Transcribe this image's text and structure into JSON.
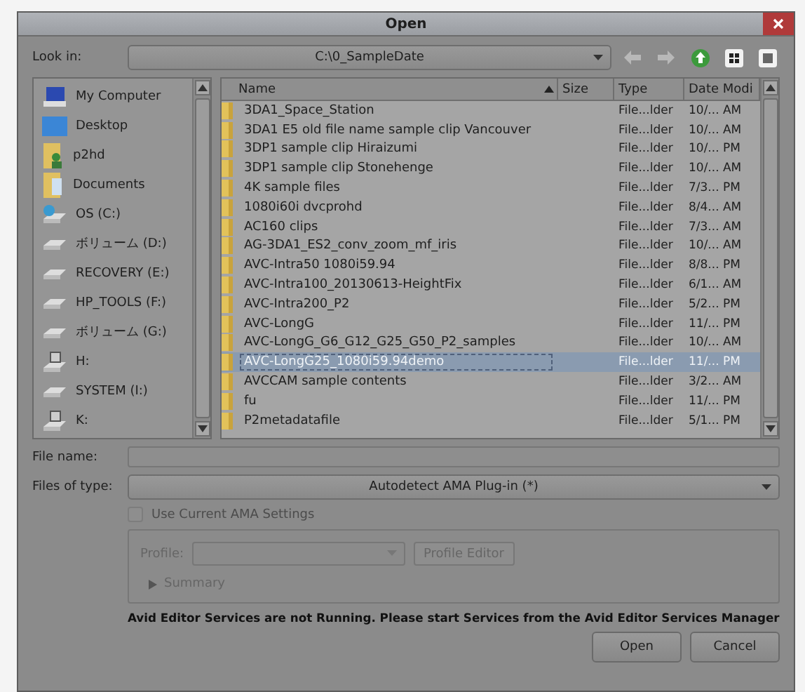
{
  "window": {
    "title": "Open"
  },
  "look_in": {
    "label": "Look in:",
    "value": "C:\\0_SampleDate"
  },
  "sidebar": {
    "items": [
      {
        "label": "My Computer",
        "kind": "computer"
      },
      {
        "label": "Desktop",
        "kind": "desktop"
      },
      {
        "label": "p2hd",
        "kind": "userfolder"
      },
      {
        "label": "Documents",
        "kind": "folder"
      },
      {
        "label": "OS (C:)",
        "kind": "osdrive"
      },
      {
        "label": "ボリューム (D:)",
        "kind": "drive"
      },
      {
        "label": "RECOVERY (E:)",
        "kind": "drive"
      },
      {
        "label": "HP_TOOLS (F:)",
        "kind": "drive"
      },
      {
        "label": "ボリューム (G:)",
        "kind": "drive"
      },
      {
        "label": "H:",
        "kind": "netdrive"
      },
      {
        "label": "SYSTEM (I:)",
        "kind": "drive"
      },
      {
        "label": "K:",
        "kind": "netdrive"
      }
    ]
  },
  "table": {
    "columns": [
      {
        "label": "Name",
        "sorted": true
      },
      {
        "label": "Size",
        "sorted": false
      },
      {
        "label": "Type",
        "sorted": false
      },
      {
        "label": "Date Modi",
        "sorted": false
      }
    ],
    "rows": [
      {
        "name": "3DA1_Space_Station",
        "type": "File...lder",
        "date": "10/... AM",
        "selected": false
      },
      {
        "name": "3DA1 E5 old file name sample clip Vancouver",
        "type": "File...lder",
        "date": "10/... AM",
        "selected": false
      },
      {
        "name": "3DP1 sample clip Hiraizumi",
        "type": "File...lder",
        "date": "10/... PM",
        "selected": false
      },
      {
        "name": "3DP1 sample clip Stonehenge",
        "type": "File...lder",
        "date": "10/... AM",
        "selected": false
      },
      {
        "name": "4K sample files",
        "type": "File...lder",
        "date": "7/3... PM",
        "selected": false
      },
      {
        "name": "1080i60i dvcprohd",
        "type": "File...lder",
        "date": "8/4... AM",
        "selected": false
      },
      {
        "name": "AC160 clips",
        "type": "File...lder",
        "date": "7/3... AM",
        "selected": false
      },
      {
        "name": "AG-3DA1_ES2_conv_zoom_mf_iris",
        "type": "File...lder",
        "date": "10/... AM",
        "selected": false
      },
      {
        "name": "AVC-Intra50 1080i59.94",
        "type": "File...lder",
        "date": "8/8... PM",
        "selected": false
      },
      {
        "name": "AVC-Intra100_20130613-HeightFix",
        "type": "File...lder",
        "date": "6/1... AM",
        "selected": false
      },
      {
        "name": "AVC-Intra200_P2",
        "type": "File...lder",
        "date": "5/2... PM",
        "selected": false
      },
      {
        "name": "AVC-LongG",
        "type": "File...lder",
        "date": "11/... PM",
        "selected": false
      },
      {
        "name": "AVC-LongG_G6_G12_G25_G50_P2_samples",
        "type": "File...lder",
        "date": "10/... AM",
        "selected": false
      },
      {
        "name": "AVC-LongG25_1080i59.94demo",
        "type": "File...lder",
        "date": "11/... PM",
        "selected": true
      },
      {
        "name": "AVCCAM sample contents",
        "type": "File...lder",
        "date": "3/2... AM",
        "selected": false
      },
      {
        "name": "fu",
        "type": "File...lder",
        "date": "11/... PM",
        "selected": false
      },
      {
        "name": "P2metadatafile",
        "type": "File...lder",
        "date": "5/1... PM",
        "selected": false
      }
    ]
  },
  "file_name": {
    "label": "File name:"
  },
  "files_of_type": {
    "label": "Files of type:",
    "value": "Autodetect AMA Plug-in (*)"
  },
  "use_current_settings": {
    "label": "Use Current AMA Settings",
    "checked": false,
    "disabled": true
  },
  "profile": {
    "label": "Profile:",
    "button": "Profile Editor"
  },
  "summary": {
    "label": "Summary",
    "expanded": false
  },
  "message": "Avid Editor Services are not Running. Please start Services from the Avid Editor Services Manager",
  "buttons": [
    "Open",
    "Cancel"
  ]
}
